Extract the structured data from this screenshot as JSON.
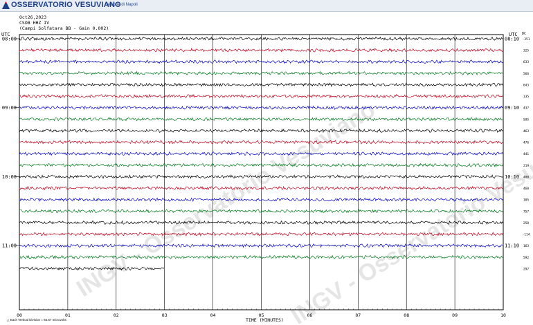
{
  "header": {
    "brand": "OSSERVATORIO VESUVIANO",
    "section": "Sezione di Napoli"
  },
  "meta": {
    "date": "Oct26,2023",
    "station": "CSOB HHZ IV",
    "desc": "(Campi Solfatara BB - Gain 0.002)"
  },
  "labels": {
    "utc_left": "UTC",
    "utc_right": "UTC",
    "dc": "DC",
    "xaxis_title": "TIME (MINUTES)",
    "footer": "Each Vertical Division =    66.67 microvolts"
  },
  "watermark": "INGV - Osservatorio Vesuviano",
  "chart_data": {
    "type": "line",
    "title": "",
    "xlabel": "TIME (MINUTES)",
    "x_ticks": [
      "00",
      "01",
      "02",
      "03",
      "04",
      "05",
      "06",
      "07",
      "08",
      "09",
      "10"
    ],
    "xlim": [
      0,
      10
    ],
    "left_hour_labels": [
      {
        "line": 0,
        "label": "08:00"
      },
      {
        "line": 6,
        "label": "09:00"
      },
      {
        "line": 12,
        "label": "10:00"
      },
      {
        "line": 18,
        "label": "11:00"
      }
    ],
    "right_hour_labels": [
      {
        "line": 0,
        "label": "08:10"
      },
      {
        "line": 6,
        "label": "09:10"
      },
      {
        "line": 12,
        "label": "10:10"
      },
      {
        "line": 18,
        "label": "11:10"
      }
    ],
    "dc_values": [
      "-351",
      "325",
      "633",
      "566",
      "643",
      "135",
      "437",
      "595",
      "463",
      "476",
      "441",
      "219",
      "400",
      "468",
      "105",
      "757",
      "258",
      "-114",
      "163",
      "592",
      "297"
    ],
    "trace_colors": [
      "#000000",
      "#c0001a",
      "#0000c8",
      "#007a1c"
    ],
    "last_trace_end_minute": 3.0,
    "events": [
      {
        "line": 18,
        "minute": 0.85,
        "amplitude": "medium"
      },
      {
        "line": 20,
        "minute": 7.85,
        "amplitude": "large"
      }
    ],
    "grid": true
  }
}
